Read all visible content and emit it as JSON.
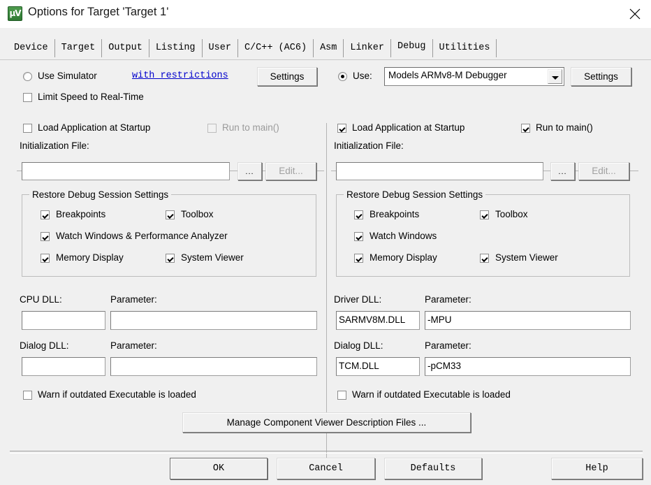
{
  "window": {
    "title": "Options for Target 'Target 1'",
    "icon": "uvision-icon",
    "close_label": "✕"
  },
  "tabs": [
    {
      "label": "Device",
      "selected": false
    },
    {
      "label": "Target",
      "selected": false
    },
    {
      "label": "Output",
      "selected": false
    },
    {
      "label": "Listing",
      "selected": false
    },
    {
      "label": "User",
      "selected": false
    },
    {
      "label": "C/C++ (AC6)",
      "selected": false
    },
    {
      "label": "Asm",
      "selected": false
    },
    {
      "label": "Linker",
      "selected": false
    },
    {
      "label": "Debug",
      "selected": true
    },
    {
      "label": "Utilities",
      "selected": false
    }
  ],
  "left_panel": {
    "simulator_radio_label": "Use Simulator",
    "simulator_radio_checked": false,
    "restrictions_link": "with restrictions",
    "settings_button": "Settings",
    "limit_speed_label": "Limit Speed to Real-Time",
    "limit_speed_checked": false,
    "load_app_label": "Load Application at Startup",
    "load_app_checked": false,
    "run_to_main_label": "Run to main()",
    "run_to_main_checked": false,
    "run_to_main_disabled": true,
    "init_file_label": "Initialization File:",
    "init_file_value": "",
    "browse_button": "...",
    "edit_button": "Edit...",
    "edit_disabled": true,
    "restore_group_title": "Restore Debug Session Settings",
    "restore_items": [
      {
        "label": "Breakpoints",
        "checked": true
      },
      {
        "label": "Toolbox",
        "checked": true
      },
      {
        "label": "Watch Windows & Performance Analyzer",
        "checked": true
      },
      {
        "label": "Memory Display",
        "checked": true
      },
      {
        "label": "System Viewer",
        "checked": true
      }
    ],
    "cpu_dll_label": "CPU DLL:",
    "cpu_dll_value": "",
    "cpu_param_label": "Parameter:",
    "cpu_param_value": "",
    "dialog_dll_label": "Dialog DLL:",
    "dialog_dll_value": "",
    "dialog_param_label": "Parameter:",
    "dialog_param_value": "",
    "warn_outdated_label": "Warn if outdated Executable is loaded",
    "warn_outdated_checked": false
  },
  "right_panel": {
    "use_radio_label": "Use:",
    "use_radio_checked": true,
    "debugger_selected": "Models ARMv8-M Debugger",
    "settings_button": "Settings",
    "load_app_label": "Load Application at Startup",
    "load_app_checked": true,
    "run_to_main_label": "Run to main()",
    "run_to_main_checked": true,
    "init_file_label": "Initialization File:",
    "init_file_value": "",
    "browse_button": "...",
    "edit_button": "Edit...",
    "edit_disabled": true,
    "restore_group_title": "Restore Debug Session Settings",
    "restore_items": [
      {
        "label": "Breakpoints",
        "checked": true
      },
      {
        "label": "Toolbox",
        "checked": true
      },
      {
        "label": "Watch Windows",
        "checked": true
      },
      {
        "label": "Memory Display",
        "checked": true
      },
      {
        "label": "System Viewer",
        "checked": true
      }
    ],
    "driver_dll_label": "Driver DLL:",
    "driver_dll_value": "SARMV8M.DLL",
    "driver_param_label": "Parameter:",
    "driver_param_value": "-MPU",
    "dialog_dll_label": "Dialog DLL:",
    "dialog_dll_value": "TCM.DLL",
    "dialog_param_label": "Parameter:",
    "dialog_param_value": "-pCM33",
    "warn_outdated_label": "Warn if outdated Executable is loaded",
    "warn_outdated_checked": false
  },
  "manage_button": "Manage Component Viewer Description Files ...",
  "footer": {
    "ok": "OK",
    "cancel": "Cancel",
    "defaults": "Defaults",
    "help": "Help"
  },
  "colors": {
    "dialog_bg": "#f0f0f0",
    "titlebar_bg": "#ffffff",
    "link": "#0000cc",
    "icon_green": "#2f7a33",
    "disabled_text": "#9a9a9a"
  }
}
